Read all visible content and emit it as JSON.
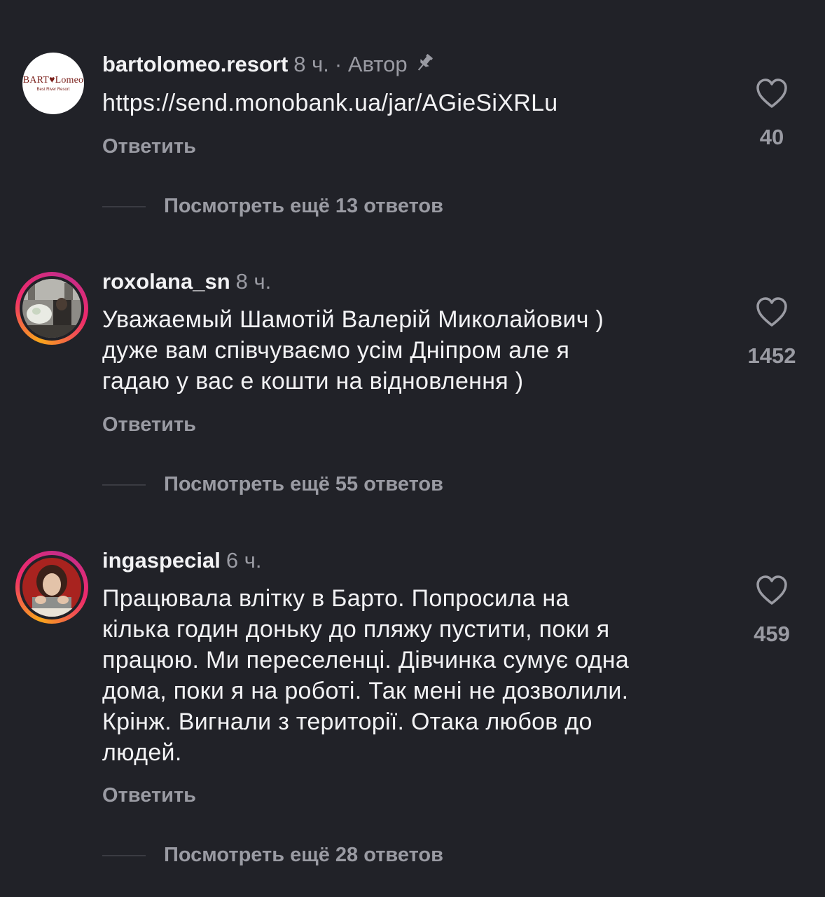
{
  "comments": [
    {
      "username": "bartolomeo.resort",
      "time": "8 ч.",
      "author_badge": "· Автор",
      "text": "https://send.monobank.ua/jar/AGieSiXRLu",
      "reply_label": "Ответить",
      "more_replies": "Посмотреть ещё 13 ответов",
      "likes": "40",
      "avatar_logo": "BART♥Lomeo",
      "avatar_logo_sub": "Best River Resort"
    },
    {
      "username": "roxolana_sn",
      "time": "8 ч.",
      "text_lines": [
        "Уважаемый Шамотій Валерій Миколайович )",
        "дуже вам співчуваємо усім Дніпром але я",
        "гадаю у вас е кошти на відновлення )"
      ],
      "reply_label": "Ответить",
      "more_replies": "Посмотреть ещё 55 ответов",
      "likes": "1452"
    },
    {
      "username": "ingaspecial",
      "time": "6 ч.",
      "text_lines": [
        "Працювала влітку в Барто. Попросила на",
        "кілька годин доньку до пляжу пустити, поки я",
        "працюю. Ми переселенці. Дівчинка сумує одна",
        "дома, поки я на роботі. Так мені не дозволили.",
        "Крінж. Вигнали з території. Отака любов до",
        "людей."
      ],
      "reply_label": "Ответить",
      "more_replies": "Посмотреть ещё 28 ответов",
      "likes": "459"
    }
  ],
  "icons": {
    "like": "heart-outline-icon",
    "pin": "pin-icon"
  },
  "colors": {
    "background": "#212228",
    "text_primary": "#f2f2f4",
    "text_secondary": "#9a9ba3",
    "story_ring_start": "#f9a61b",
    "story_ring_end": "#c42d8b"
  }
}
